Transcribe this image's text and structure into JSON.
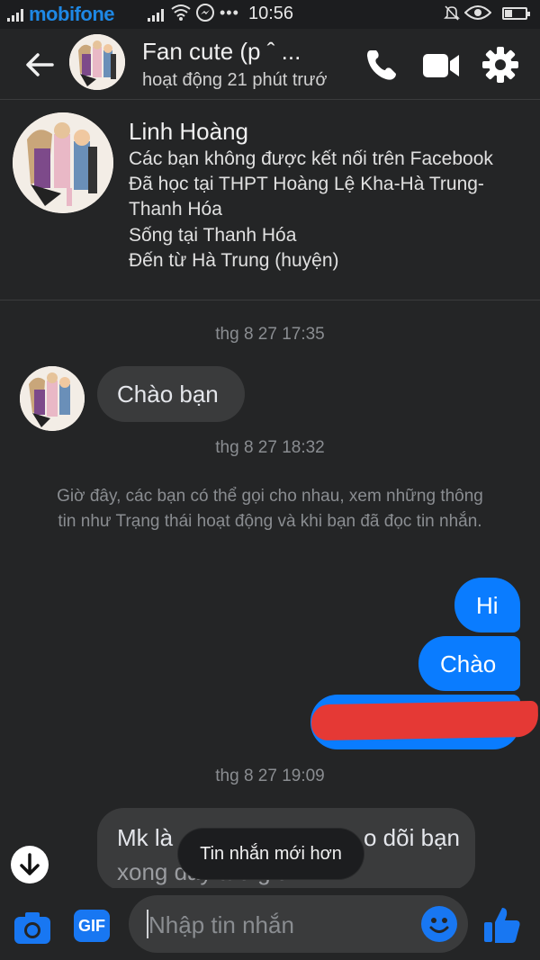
{
  "status_bar": {
    "carrier": "mobifone",
    "time": "10:56"
  },
  "header": {
    "title": "Fan cute (p ˆ ...",
    "subtitle": "hoạt động 21 phút trướ",
    "icons": [
      "back-arrow-icon",
      "phone-icon",
      "video-camera-icon",
      "gear-icon"
    ]
  },
  "profile": {
    "name": "Linh Hoàng",
    "lines": [
      "Các bạn không được kết nối trên Facebook",
      "Đã học tại THPT Hoàng Lệ Kha-Hà Trung-",
      "Thanh Hóa",
      "Sống tại Thanh Hóa",
      "Đến từ Hà Trung (huyện)"
    ]
  },
  "chat": {
    "timestamps": [
      "thg 8 27 17:35",
      "thg 8 27 18:32",
      "thg 8 27 19:09"
    ],
    "system_message": "Giờ đây, các bạn có thể gọi cho nhau, xem những thông tin như Trạng thái hoạt động và khi bạn đã đọc tin nhắn.",
    "incoming_1": "Chào bạn",
    "outgoing_1": "Hi",
    "outgoing_2": "Chào",
    "incoming_2_line1_left": "Mk là",
    "incoming_2_line1_right": "o dõi bạn",
    "incoming_2_line2": "xong đây tao giờ"
  },
  "toast": {
    "text": "Tin nhắn mới hơn"
  },
  "composer": {
    "placeholder": "Nhập tin nhắn",
    "gif_label": "GIF"
  },
  "colors": {
    "accent": "#0a7cff",
    "background": "#242526",
    "bubble_in": "#3a3b3c",
    "redaction": "#e53935"
  }
}
